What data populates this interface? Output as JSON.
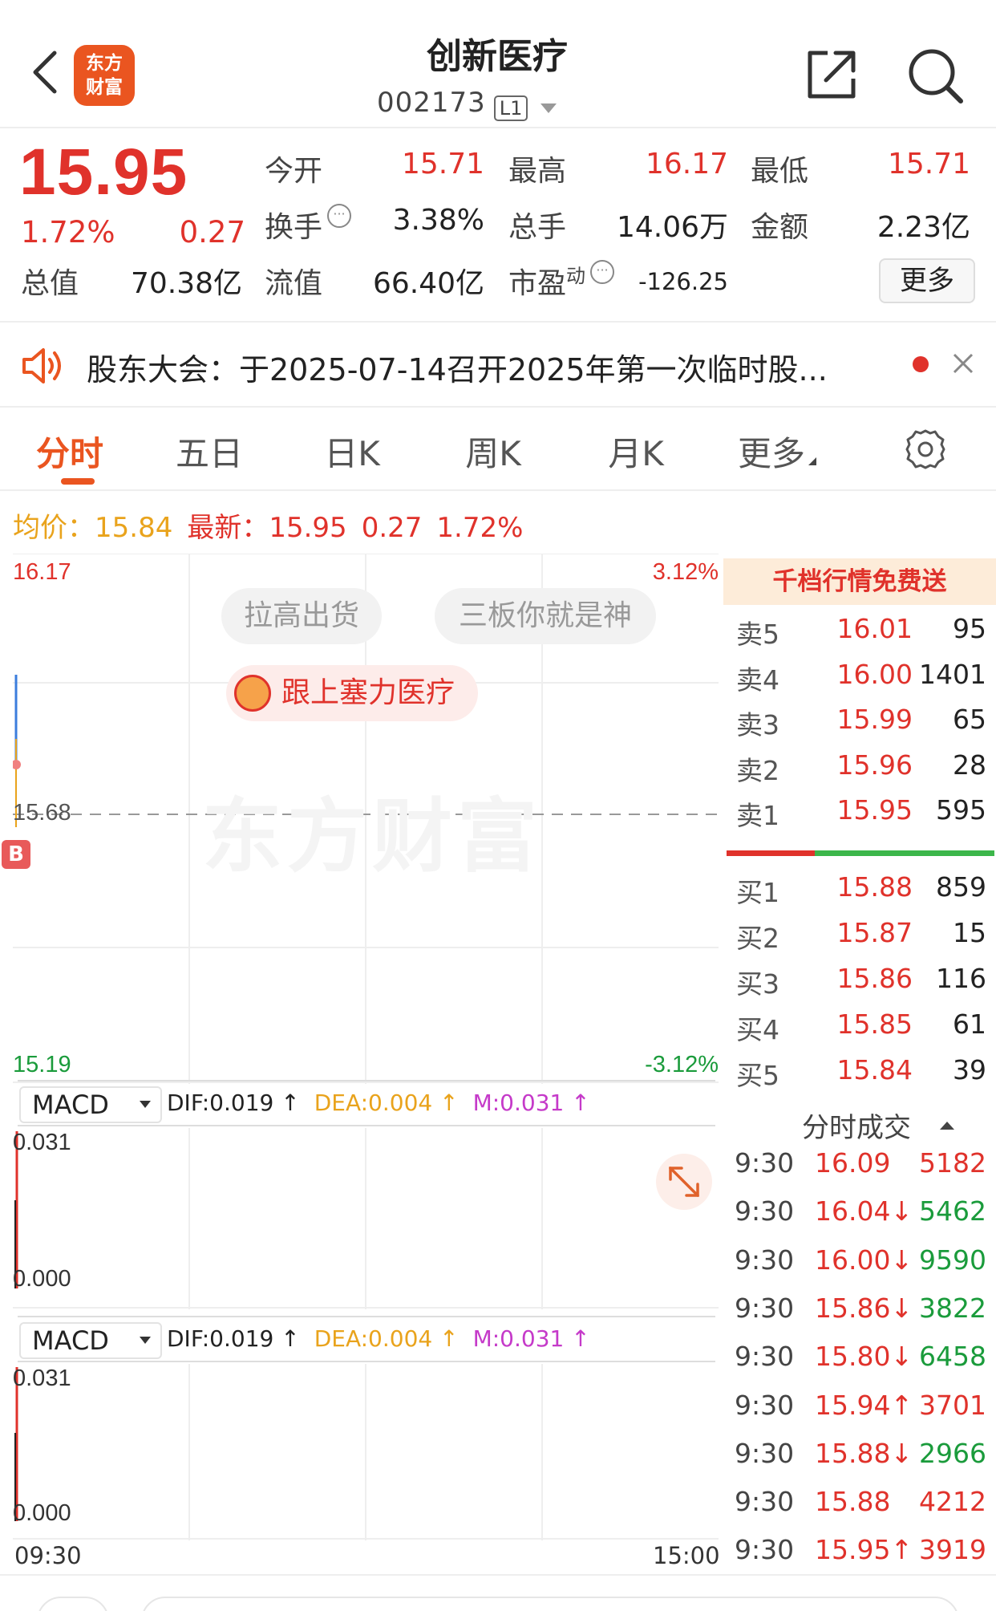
{
  "header": {
    "logo_line1": "东方",
    "logo_line2": "财富",
    "title": "创新医疗",
    "code": "002173",
    "level": "L1"
  },
  "quote": {
    "price": "15.95",
    "change_pct": "1.72%",
    "change_amt": "0.27",
    "stats": {
      "open_label": "今开",
      "open": "15.71",
      "high_label": "最高",
      "high": "16.17",
      "low_label": "最低",
      "low": "15.71",
      "turnover_label": "换手",
      "turnover": "3.38%",
      "volume_label": "总手",
      "volume": "14.06万",
      "amount_label": "金额",
      "amount": "2.23亿",
      "mktcap_label": "总值",
      "mktcap": "70.38亿",
      "float_label": "流值",
      "float": "66.40亿",
      "pe_label": "市盈",
      "pe_sup": "动",
      "pe": "-126.25"
    },
    "more_label": "更多"
  },
  "notice": {
    "text": "股东大会：于2025-07-14召开2025年第一次临时股..."
  },
  "tabs": [
    "分时",
    "五日",
    "日K",
    "周K",
    "月K",
    "更多"
  ],
  "price_line": {
    "avg_label": "均价：",
    "avg": "15.84",
    "latest_label": "最新：",
    "latest": "15.95",
    "chg": "0.27",
    "pct": "1.72%"
  },
  "main_chart": {
    "y_max": "16.17",
    "y_mid": "15.68",
    "y_min": "15.19",
    "pct_max": "3.12%",
    "pct_min": "-3.12%",
    "marker": "B",
    "watermark": "东方财富",
    "pills": [
      "拉高出货",
      "三板你就是神"
    ],
    "follow_pill": "跟上塞力医疗"
  },
  "macd": [
    {
      "name": "MACD",
      "dif": "DIF:0.019 ↑",
      "dea": "DEA:0.004 ↑",
      "m": "M:0.031 ↑",
      "y_max": "0.031",
      "y_min": "0.000"
    },
    {
      "name": "MACD",
      "dif": "DIF:0.019 ↑",
      "dea": "DEA:0.004 ↑",
      "m": "M:0.031 ↑",
      "y_max": "0.031",
      "y_min": "0.000"
    }
  ],
  "time_axis": {
    "start": "09:30",
    "end": "15:00"
  },
  "order_book": {
    "banner": "千档行情免费送",
    "asks": [
      {
        "label": "卖5",
        "price": "16.01",
        "vol": "95"
      },
      {
        "label": "卖4",
        "price": "16.00",
        "vol": "1401"
      },
      {
        "label": "卖3",
        "price": "15.99",
        "vol": "65"
      },
      {
        "label": "卖2",
        "price": "15.96",
        "vol": "28"
      },
      {
        "label": "卖1",
        "price": "15.95",
        "vol": "595"
      }
    ],
    "bids": [
      {
        "label": "买1",
        "price": "15.88",
        "vol": "859"
      },
      {
        "label": "买2",
        "price": "15.87",
        "vol": "15"
      },
      {
        "label": "买3",
        "price": "15.86",
        "vol": "116"
      },
      {
        "label": "买4",
        "price": "15.85",
        "vol": "61"
      },
      {
        "label": "买5",
        "price": "15.84",
        "vol": "39"
      }
    ]
  },
  "ticks": {
    "title": "分时成交",
    "rows": [
      {
        "time": "9:30",
        "price": "16.09",
        "vol": "5182",
        "pc": "red",
        "vc": "red"
      },
      {
        "time": "9:30",
        "price": "16.04↓",
        "vol": "5462",
        "pc": "red",
        "vc": "green"
      },
      {
        "time": "9:30",
        "price": "16.00↓",
        "vol": "9590",
        "pc": "red",
        "vc": "green"
      },
      {
        "time": "9:30",
        "price": "15.86↓",
        "vol": "3822",
        "pc": "red",
        "vc": "green"
      },
      {
        "time": "9:30",
        "price": "15.80↓",
        "vol": "6458",
        "pc": "red",
        "vc": "green"
      },
      {
        "time": "9:30",
        "price": "15.94↑",
        "vol": "3701",
        "pc": "red",
        "vc": "red"
      },
      {
        "time": "9:30",
        "price": "15.88↓",
        "vol": "2966",
        "pc": "red",
        "vc": "green"
      },
      {
        "time": "9:30",
        "price": "15.88",
        "vol": "4212",
        "pc": "red",
        "vc": "red"
      },
      {
        "time": "9:30",
        "price": "15.95↑",
        "vol": "3919",
        "pc": "red",
        "vc": "red"
      }
    ]
  },
  "colors": {
    "up": "#e0322b",
    "down": "#1a9b3b",
    "accent": "#ea5520",
    "avg": "#e9a31c",
    "macd_m": "#c53ac9"
  },
  "icons": [
    "back-chevron-icon",
    "share-icon",
    "search-icon",
    "speaker-icon",
    "close-icon",
    "gear-icon",
    "expand-icon",
    "info-icon"
  ]
}
